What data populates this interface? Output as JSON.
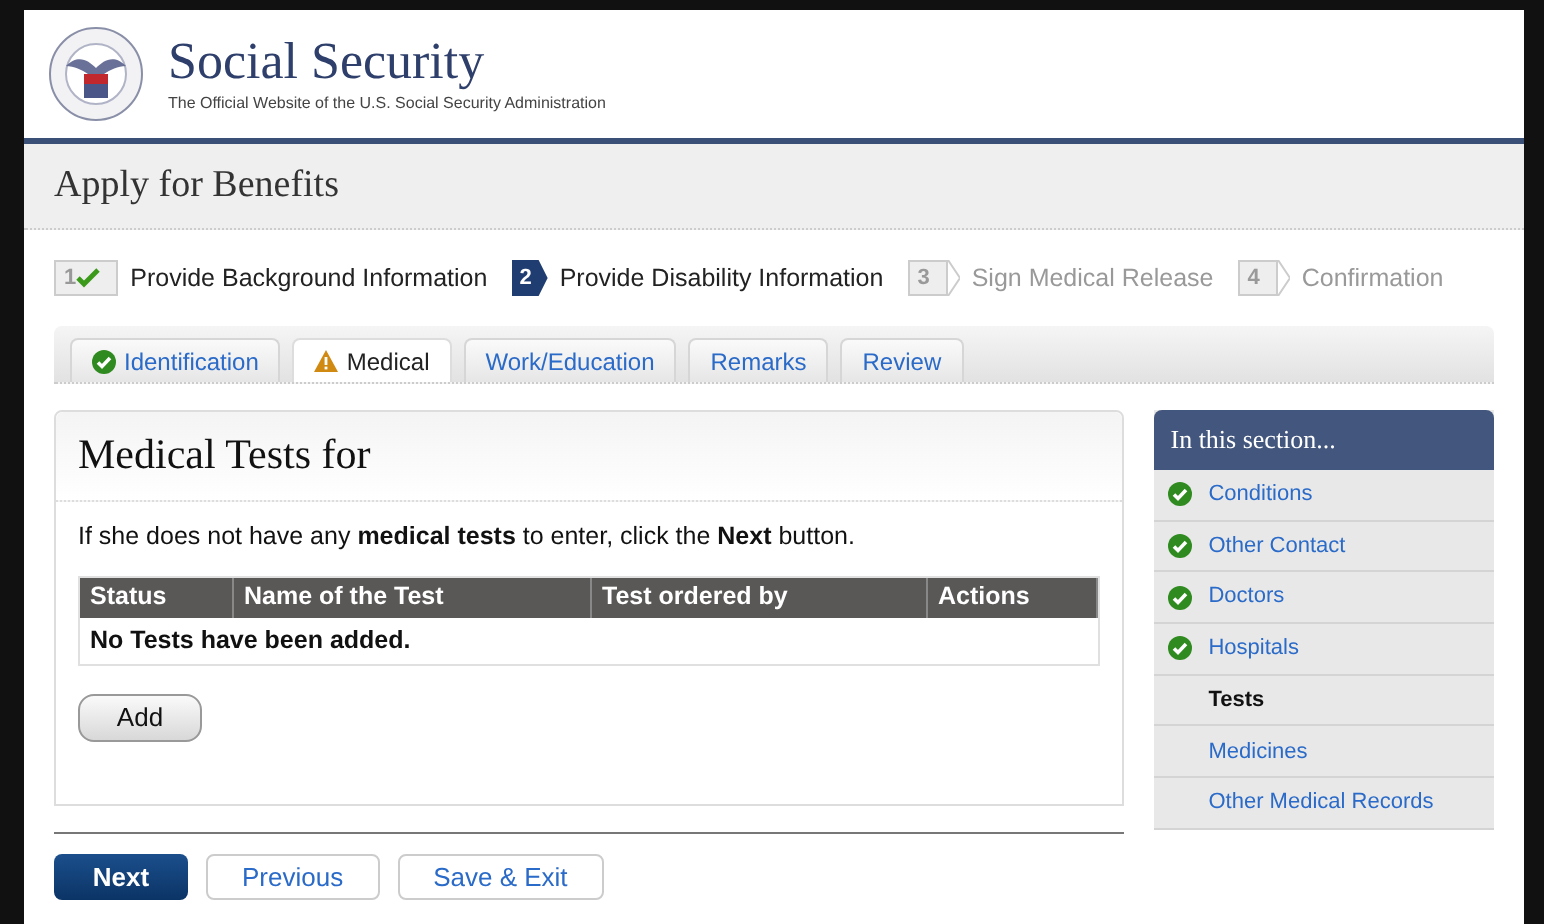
{
  "header": {
    "title": "Social Security",
    "subtitle": "The Official Website of the U.S. Social Security Administration"
  },
  "page_title": "Apply for Benefits",
  "steps": [
    {
      "number": "1",
      "label": "Provide Background Information",
      "done": true,
      "selected": false
    },
    {
      "number": "2",
      "label": "Provide Disability Information",
      "done": false,
      "selected": true
    },
    {
      "number": "3",
      "label": "Sign Medical Release",
      "done": false,
      "selected": false
    },
    {
      "number": "4",
      "label": "Confirmation",
      "done": false,
      "selected": false
    }
  ],
  "tabs": [
    {
      "label": "Identification",
      "selected": false,
      "complete": true,
      "warning": false
    },
    {
      "label": "Medical",
      "selected": true,
      "complete": false,
      "warning": true
    },
    {
      "label": "Work/Education",
      "selected": false,
      "complete": false,
      "warning": false
    },
    {
      "label": "Remarks",
      "selected": false,
      "complete": false,
      "warning": false
    },
    {
      "label": "Review",
      "selected": false,
      "complete": false,
      "warning": false
    }
  ],
  "panel": {
    "title": "Medical Tests for",
    "instruction": "If she does not have any **medical tests** to enter, click the **Next** button.",
    "table": {
      "columns": [
        "Status",
        "Name of the Test",
        "Test ordered by",
        "Actions"
      ],
      "empty_message": "No Tests have been added."
    },
    "add_button": "Add"
  },
  "sidebar": {
    "title": "In this section...",
    "items": [
      {
        "label": "Conditions",
        "complete": true,
        "selected": false
      },
      {
        "label": "Other Contact",
        "complete": true,
        "selected": false
      },
      {
        "label": "Doctors",
        "complete": true,
        "selected": false
      },
      {
        "label": "Hospitals",
        "complete": true,
        "selected": false
      },
      {
        "label": "Tests",
        "complete": false,
        "selected": true
      },
      {
        "label": "Medicines",
        "complete": false,
        "selected": false
      },
      {
        "label": "Other Medical Records",
        "complete": false,
        "selected": false
      }
    ]
  },
  "buttons": [
    {
      "label": "Next",
      "kind": "primary"
    },
    {
      "label": "Previous",
      "kind": "secondary"
    },
    {
      "label": "Save & Exit",
      "kind": "secondary"
    }
  ]
}
